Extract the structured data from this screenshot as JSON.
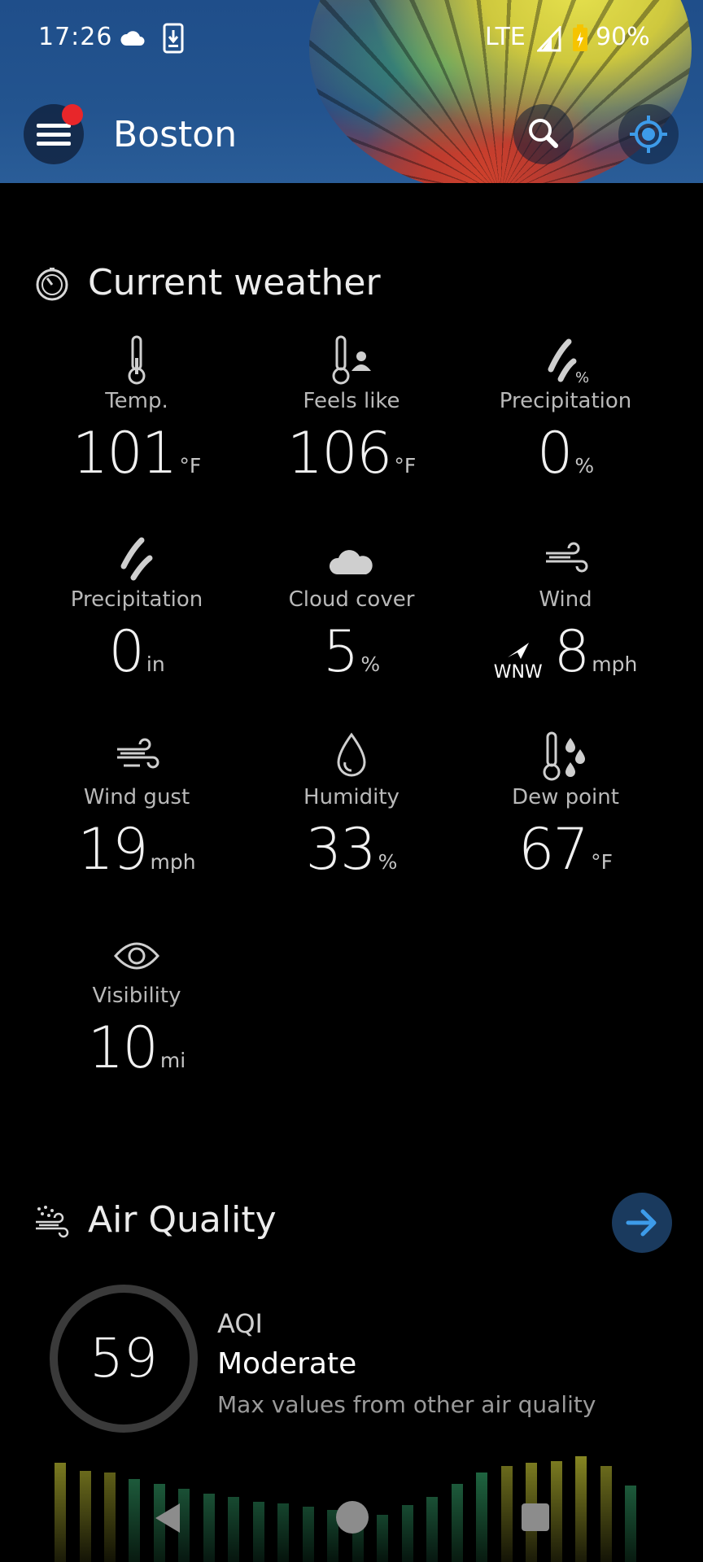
{
  "status_bar": {
    "time": "17:26",
    "network": "LTE",
    "battery": "90%",
    "icons": [
      "cloud-notification-icon",
      "download-icon",
      "signal-icon",
      "battery-charging-icon"
    ]
  },
  "header": {
    "city": "Boston",
    "menu_has_badge": true,
    "badge_color": "#e8262a",
    "icons": [
      "hamburger-menu-icon",
      "search-icon",
      "my-location-icon"
    ]
  },
  "current_weather": {
    "title": "Current weather",
    "items": [
      {
        "label": "Temp.",
        "value": "101",
        "unit": "°F",
        "icon": "thermometer-icon"
      },
      {
        "label": "Feels like",
        "value": "106",
        "unit": "°F",
        "icon": "thermometer-person-icon"
      },
      {
        "label": "Precipitation",
        "value": "0",
        "unit": "%",
        "icon": "precipitation-percent-icon"
      },
      {
        "label": "Precipitation",
        "value": "0",
        "unit": "in",
        "icon": "precipitation-icon"
      },
      {
        "label": "Cloud cover",
        "value": "5",
        "unit": "%",
        "icon": "cloud-icon"
      },
      {
        "label": "Wind",
        "value": "8",
        "unit": "mph",
        "direction": "WNW",
        "icon": "wind-icon"
      },
      {
        "label": "Wind gust",
        "value": "19",
        "unit": "mph",
        "icon": "wind-gust-icon"
      },
      {
        "label": "Humidity",
        "value": "33",
        "unit": "%",
        "icon": "humidity-drop-icon"
      },
      {
        "label": "Dew point",
        "value": "67",
        "unit": "°F",
        "icon": "dew-point-icon"
      },
      {
        "label": "Visibility",
        "value": "10",
        "unit": "mi",
        "icon": "eye-icon"
      }
    ]
  },
  "air_quality": {
    "title": "Air Quality",
    "aqi_value": "59",
    "aqi_label": "AQI",
    "category": "Moderate",
    "description": "Max values from other air quality",
    "accent_color": "#3d9be9"
  },
  "colors": {
    "background": "#000000",
    "header_blue": "#23548f",
    "label_gray": "#b9b9b9"
  }
}
